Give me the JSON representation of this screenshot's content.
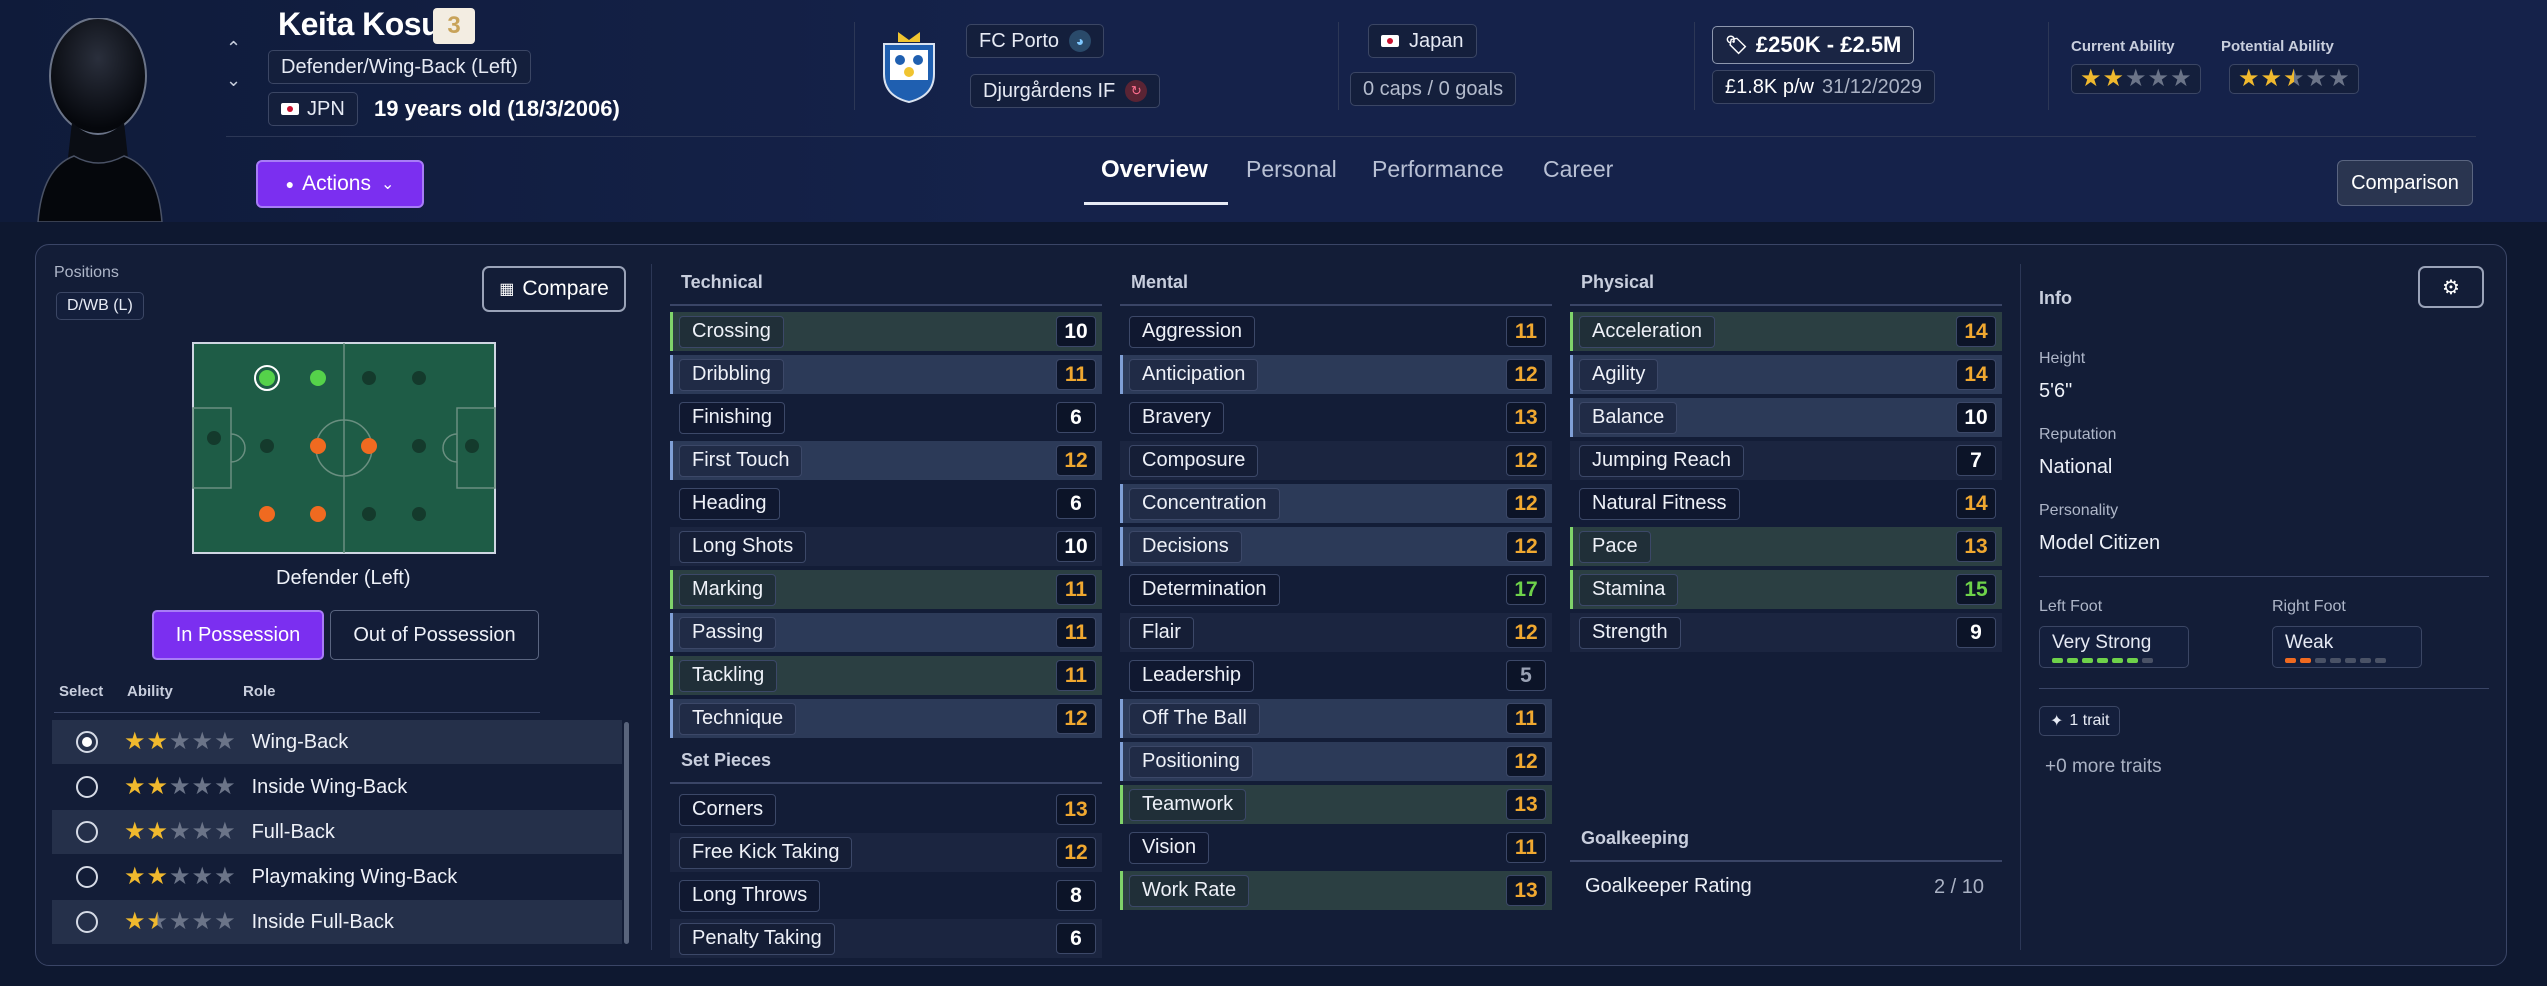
{
  "player": {
    "name": "Keita Kosugi",
    "squad_number": "3",
    "position": "Defender/Wing-Back (Left)",
    "nationality_code": "JPN",
    "age_text": "19 years old (18/3/2006)"
  },
  "club": {
    "name": "FC Porto",
    "loan_club": "Djurgårdens IF"
  },
  "country": {
    "name": "Japan",
    "caps_goals": "0 caps / 0 goals"
  },
  "contract": {
    "value": "£250K - £2.5M",
    "wage": "£1.8K p/w",
    "expiry": "31/12/2029"
  },
  "ability": {
    "current_label": "Current Ability",
    "potential_label": "Potential Ability",
    "current_stars": 2,
    "potential_stars": 2.5
  },
  "actions_label": "Actions",
  "tabs": [
    "Overview",
    "Personal",
    "Performance",
    "Career"
  ],
  "comparison_label": "Comparison",
  "positions": {
    "title": "Positions",
    "code": "D/WB (L)",
    "compare_label": "Compare",
    "role_name": "Defender (Left)",
    "in_possession": "In Possession",
    "out_possession": "Out of Possession",
    "col_select": "Select",
    "col_ability": "Ability",
    "col_role": "Role",
    "roles": [
      {
        "name": "Wing-Back",
        "stars": 2,
        "selected": true
      },
      {
        "name": "Inside Wing-Back",
        "stars": 2,
        "selected": false
      },
      {
        "name": "Full-Back",
        "stars": 2,
        "selected": false
      },
      {
        "name": "Playmaking Wing-Back",
        "stars": 2,
        "selected": false
      },
      {
        "name": "Inside Full-Back",
        "stars": 1.5,
        "selected": false
      }
    ]
  },
  "technical": {
    "title": "Technical",
    "attrs": [
      {
        "name": "Crossing",
        "value": "10",
        "hl": "green"
      },
      {
        "name": "Dribbling",
        "value": "11",
        "hl": "blue"
      },
      {
        "name": "Finishing",
        "value": "6",
        "hl": ""
      },
      {
        "name": "First Touch",
        "value": "12",
        "hl": "blue"
      },
      {
        "name": "Heading",
        "value": "6",
        "hl": ""
      },
      {
        "name": "Long Shots",
        "value": "10",
        "hl": ""
      },
      {
        "name": "Marking",
        "value": "11",
        "hl": "green"
      },
      {
        "name": "Passing",
        "value": "11",
        "hl": "blue"
      },
      {
        "name": "Tackling",
        "value": "11",
        "hl": "green"
      },
      {
        "name": "Technique",
        "value": "12",
        "hl": "blue"
      }
    ]
  },
  "set_pieces": {
    "title": "Set Pieces",
    "attrs": [
      {
        "name": "Corners",
        "value": "13",
        "hl": ""
      },
      {
        "name": "Free Kick Taking",
        "value": "12",
        "hl": ""
      },
      {
        "name": "Long Throws",
        "value": "8",
        "hl": ""
      },
      {
        "name": "Penalty Taking",
        "value": "6",
        "hl": ""
      }
    ]
  },
  "mental": {
    "title": "Mental",
    "attrs": [
      {
        "name": "Aggression",
        "value": "11",
        "hl": ""
      },
      {
        "name": "Anticipation",
        "value": "12",
        "hl": "blue"
      },
      {
        "name": "Bravery",
        "value": "13",
        "hl": ""
      },
      {
        "name": "Composure",
        "value": "12",
        "hl": ""
      },
      {
        "name": "Concentration",
        "value": "12",
        "hl": "blue"
      },
      {
        "name": "Decisions",
        "value": "12",
        "hl": "blue"
      },
      {
        "name": "Determination",
        "value": "17",
        "hl": ""
      },
      {
        "name": "Flair",
        "value": "12",
        "hl": ""
      },
      {
        "name": "Leadership",
        "value": "5",
        "hl": ""
      },
      {
        "name": "Off The Ball",
        "value": "11",
        "hl": "blue"
      },
      {
        "name": "Positioning",
        "value": "12",
        "hl": "blue"
      },
      {
        "name": "Teamwork",
        "value": "13",
        "hl": "green"
      },
      {
        "name": "Vision",
        "value": "11",
        "hl": ""
      },
      {
        "name": "Work Rate",
        "value": "13",
        "hl": "green"
      }
    ]
  },
  "physical": {
    "title": "Physical",
    "attrs": [
      {
        "name": "Acceleration",
        "value": "14",
        "hl": "green"
      },
      {
        "name": "Agility",
        "value": "14",
        "hl": "blue"
      },
      {
        "name": "Balance",
        "value": "10",
        "hl": "blue"
      },
      {
        "name": "Jumping Reach",
        "value": "7",
        "hl": ""
      },
      {
        "name": "Natural Fitness",
        "value": "14",
        "hl": ""
      },
      {
        "name": "Pace",
        "value": "13",
        "hl": "green"
      },
      {
        "name": "Stamina",
        "value": "15",
        "hl": "green"
      },
      {
        "name": "Strength",
        "value": "9",
        "hl": ""
      }
    ]
  },
  "goalkeeping": {
    "title": "Goalkeeping",
    "rating_label": "Goalkeeper Rating",
    "rating_value": "2 / 10"
  },
  "info": {
    "title": "Info",
    "height_label": "Height",
    "height": "5'6\"",
    "reputation_label": "Reputation",
    "reputation": "National",
    "personality_label": "Personality",
    "personality": "Model Citizen",
    "left_foot_label": "Left Foot",
    "left_foot": "Very Strong",
    "left_foot_level": 6,
    "right_foot_label": "Right Foot",
    "right_foot": "Weak",
    "right_foot_level": 2,
    "traits_label": "1 trait",
    "more_traits": "+0 more traits"
  },
  "colors": {
    "accent_purple": "#7b2ff0",
    "value_orange": "#f0a830",
    "value_green": "#6ed24a",
    "pitch_green": "#1e5c46"
  }
}
